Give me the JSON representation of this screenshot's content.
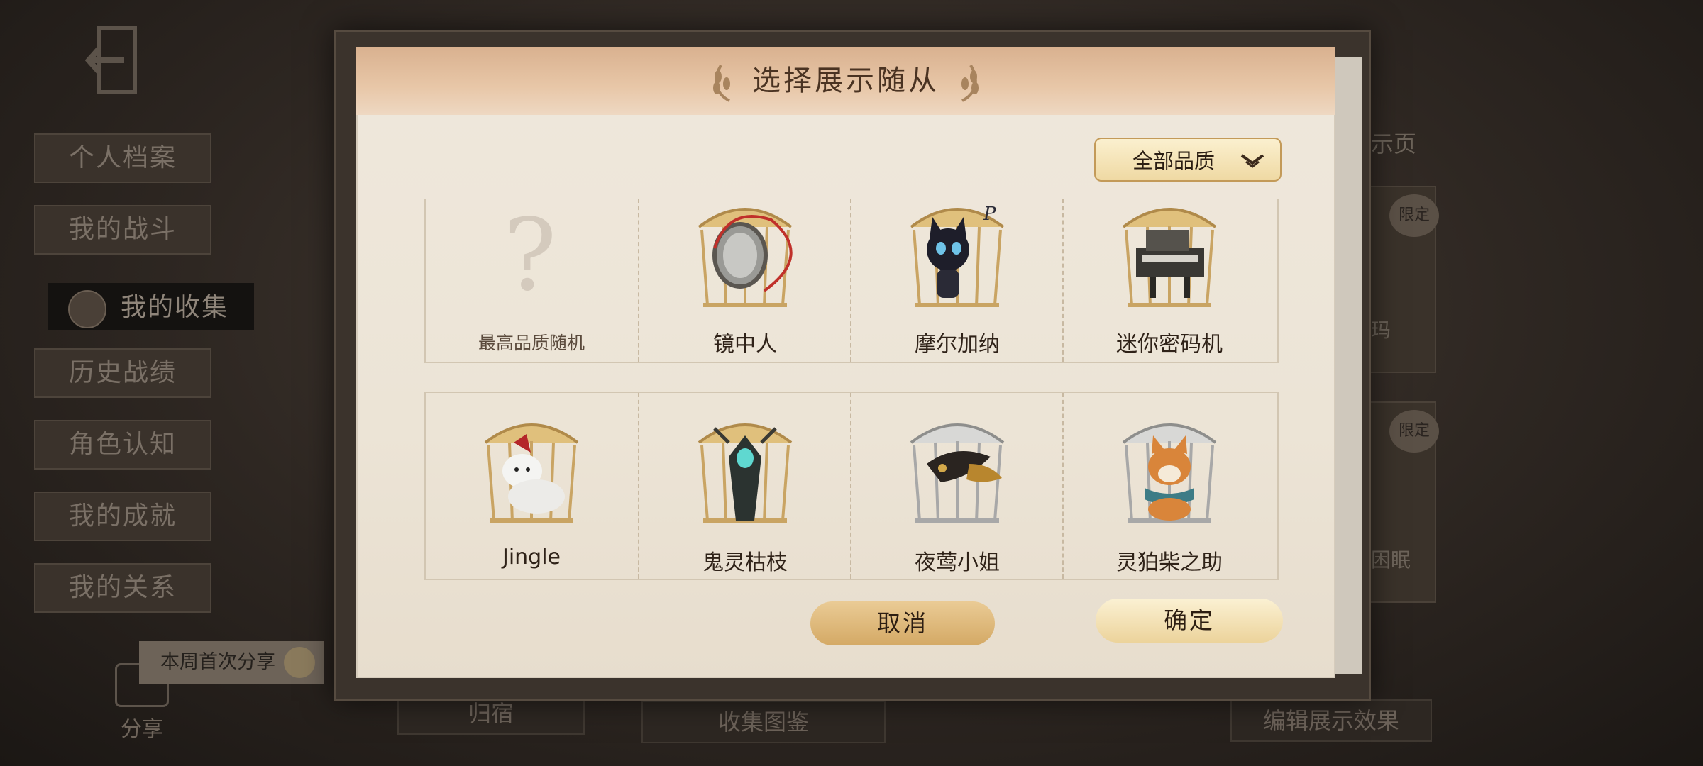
{
  "background": {
    "side_menu": [
      "个人档案",
      "我的战斗",
      "我的收集",
      "历史战绩",
      "角色认知",
      "我的成就",
      "我的关系"
    ],
    "active_menu": "我的收集",
    "share_tip": "本周首次分享",
    "share_label": "分享",
    "bottom_tabs": [
      "归宿",
      "收集图鉴",
      "编辑展示效果"
    ],
    "right_label": "展示页",
    "right_cards": [
      {
        "badge": "限定",
        "text": "玛"
      },
      {
        "badge": "限定",
        "text": "困眠"
      }
    ]
  },
  "modal": {
    "title": "选择展示随从",
    "quality_filter": "全部品质",
    "pets": [
      {
        "name": "最高品质随机",
        "icon": "question-mark-icon"
      },
      {
        "name": "镜中人",
        "icon": "mirror-pet-icon",
        "cage": "gold"
      },
      {
        "name": "摩尔加纳",
        "icon": "cat-pet-icon",
        "cage": "gold"
      },
      {
        "name": "迷你密码机",
        "icon": "cipher-machine-pet-icon",
        "cage": "gold"
      },
      {
        "name": "Jingle",
        "icon": "white-fox-pet-icon",
        "cage": "gold"
      },
      {
        "name": "鬼灵枯枝",
        "icon": "ghost-branch-pet-icon",
        "cage": "gold"
      },
      {
        "name": "夜莺小姐",
        "icon": "feather-mask-pet-icon",
        "cage": "silver"
      },
      {
        "name": "灵狛柴之助",
        "icon": "shiba-pet-icon",
        "cage": "silver"
      }
    ],
    "cancel_label": "取消",
    "confirm_label": "确定"
  },
  "colors": {
    "gold_cage": "#c9a463",
    "silver_cage": "#a8a8a8",
    "header": "#dcb594",
    "paper": "#ece4d6"
  }
}
